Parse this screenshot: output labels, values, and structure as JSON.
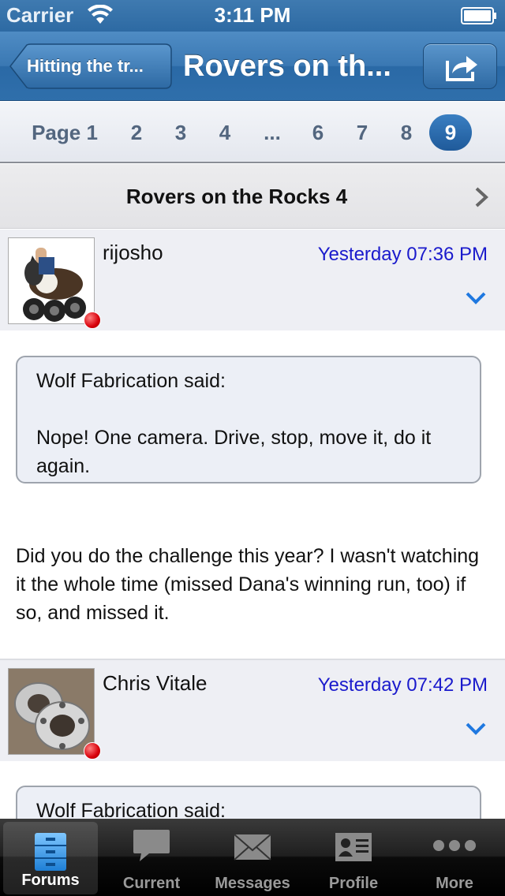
{
  "status_bar": {
    "carrier": "Carrier",
    "time": "3:11 PM"
  },
  "nav": {
    "back_label": "Hitting the tr...",
    "title": "Rovers on th..."
  },
  "pager": {
    "items": [
      "Page 1",
      "2",
      "3",
      "4",
      "...",
      "6",
      "7",
      "8",
      "9"
    ],
    "current": "9"
  },
  "thread": {
    "title": "Rovers on the Rocks 4"
  },
  "posts": [
    {
      "username": "rijosho",
      "date": "Yesterday 07:36 PM",
      "quote_author": "Wolf Fabrication said:",
      "quote_text": "Nope!  One camera.  Drive, stop, move it, do it again.",
      "text": "Did you do the challenge this year?  I wasn't watching it the whole time (missed Dana's winning run, too) if so, and missed it."
    },
    {
      "username": "Chris Vitale",
      "date": "Yesterday 07:42 PM",
      "quote_author": "Wolf Fabrication said:"
    }
  ],
  "tabs": [
    {
      "label": "Forums",
      "icon": "cabinet-icon",
      "active": true
    },
    {
      "label": "Current",
      "icon": "speech-bubble-icon",
      "active": false
    },
    {
      "label": "Messages",
      "icon": "envelope-icon",
      "active": false
    },
    {
      "label": "Profile",
      "icon": "id-card-icon",
      "active": false
    },
    {
      "label": "More",
      "icon": "more-dots-icon",
      "active": false
    }
  ],
  "colors": {
    "nav_blue": "#3a78b3",
    "date_blue": "#1a1acc",
    "status_red": "#d8000a"
  }
}
